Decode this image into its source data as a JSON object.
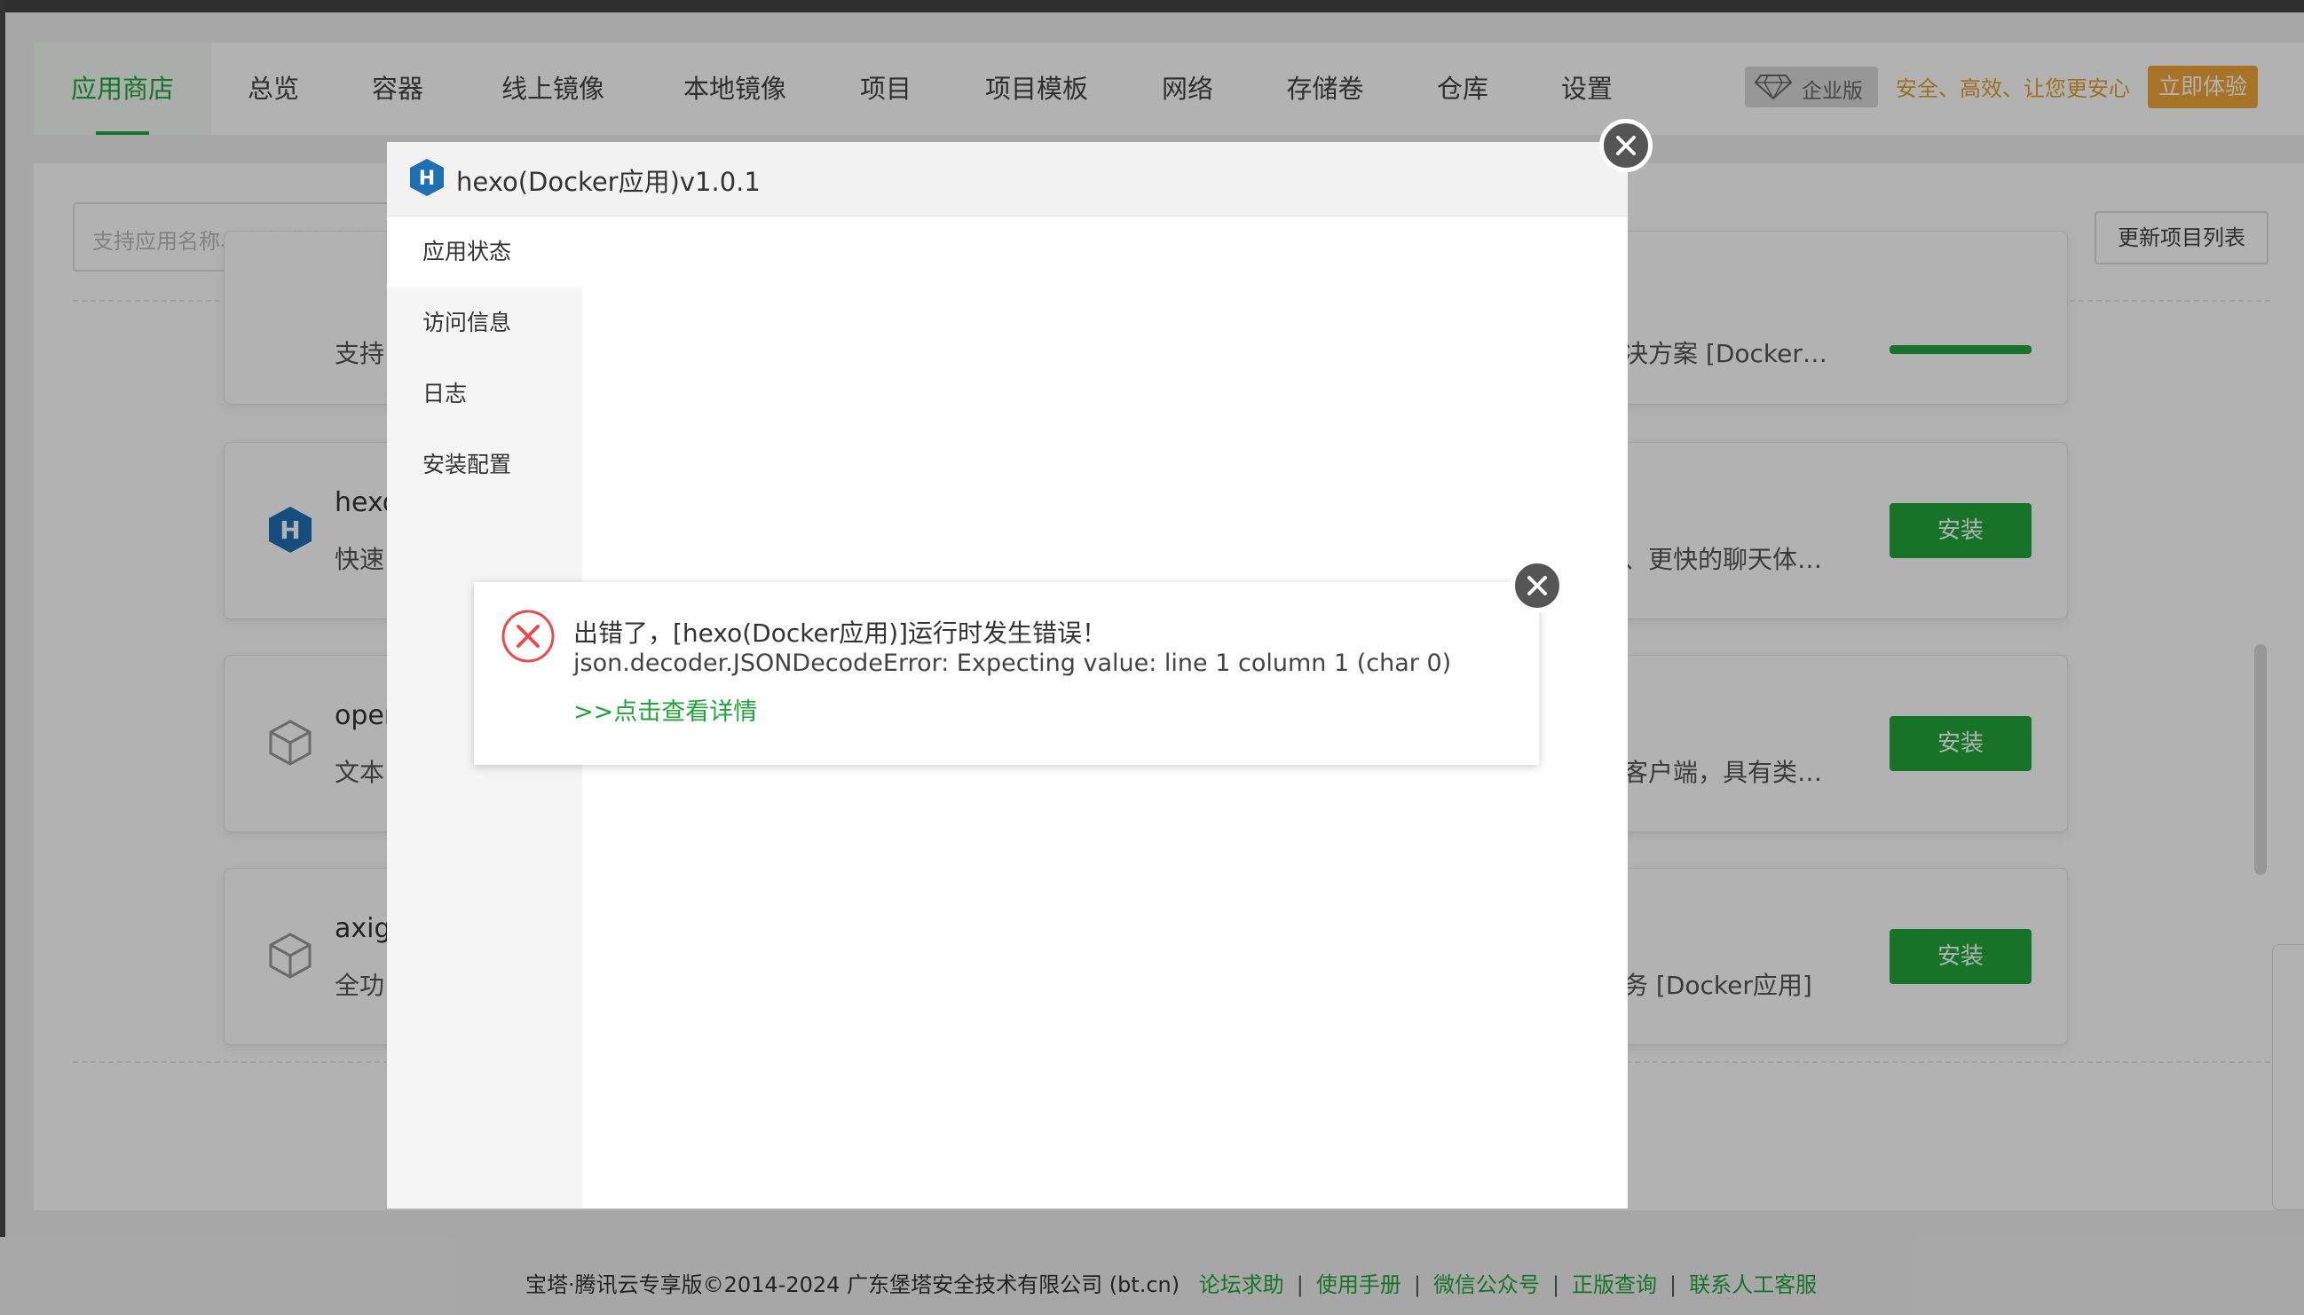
{
  "nav": {
    "tabs": [
      "应用商店",
      "总览",
      "容器",
      "线上镜像",
      "本地镜像",
      "项目",
      "项目模板",
      "网络",
      "存储卷",
      "仓库",
      "设置"
    ],
    "enterprise_label": "企业版",
    "slogan": "安全、高效、让您更安心",
    "try_button": "立即体验"
  },
  "search": {
    "placeholder": "支持应用名称、字段模糊搜索"
  },
  "refresh_button": "更新项目列表",
  "apps": [
    {
      "name": "",
      "desc": "支持",
      "right": "决方案 [Docker…",
      "button": ""
    },
    {
      "name": "hexo",
      "desc": "快速",
      "right": "、更快的聊天体…",
      "button": "安装"
    },
    {
      "name": "oper",
      "desc": "文本",
      "right": "客户端，具有类…",
      "button": "安装"
    },
    {
      "name": "axig",
      "desc": "全功",
      "right": "务 [Docker应用]",
      "button": "安装"
    }
  ],
  "app_modal": {
    "title": "hexo(Docker应用)v1.0.1",
    "menu": [
      "应用状态",
      "访问信息",
      "日志",
      "安装配置"
    ]
  },
  "error_dialog": {
    "title": "出错了，[hexo(Docker应用)]运行时发生错误！",
    "message": "json.decoder.JSONDecodeError: Expecting value: line 1 column 1 (char 0)",
    "link": ">>点击查看详情"
  },
  "footer": {
    "copyright": "宝塔·腾讯云专享版©2014-2024 广东堡塔安全技术有限公司 (bt.cn)",
    "links": [
      "论坛求助",
      "使用手册",
      "微信公众号",
      "正版查询",
      "联系人工客服"
    ]
  },
  "colors": {
    "accent": "#20a53a",
    "warning": "#f0a537",
    "error": "#e84c4c",
    "hexo_blue": "#1f6fb5"
  }
}
